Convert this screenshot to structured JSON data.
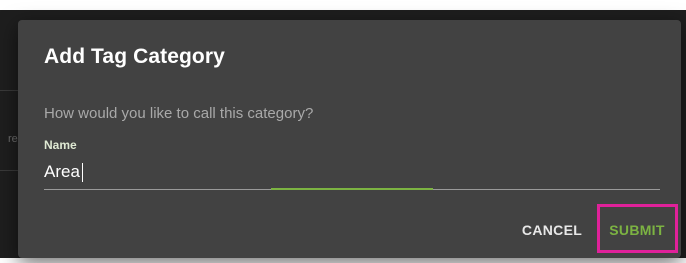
{
  "dialog": {
    "title": "Add Tag Category",
    "prompt": "How would you like to call this category?",
    "field": {
      "label": "Name",
      "value": "Area"
    },
    "actions": {
      "cancel_label": "CANCEL",
      "submit_label": "SUBMIT"
    }
  },
  "background": {
    "fragment_text": "re"
  },
  "colors": {
    "dialog_bg": "#424242",
    "backdrop": "#1e1e1e",
    "accent": "#7cb342",
    "highlight": "#e0219a"
  }
}
